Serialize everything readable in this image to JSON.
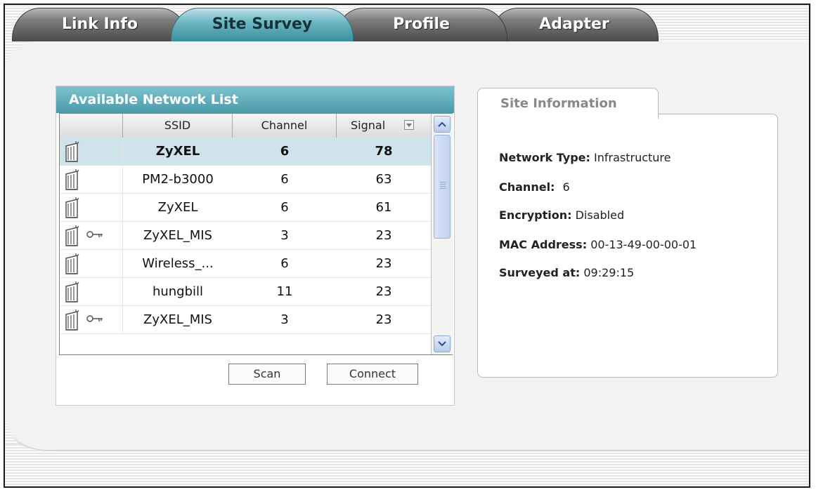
{
  "tabs": [
    {
      "label": "Link Info"
    },
    {
      "label": "Site Survey"
    },
    {
      "label": "Profile"
    },
    {
      "label": "Adapter"
    }
  ],
  "network_list": {
    "title": "Available Network List",
    "columns": {
      "ssid": "SSID",
      "channel": "Channel",
      "signal": "Signal"
    },
    "rows": [
      {
        "ssid": "ZyXEL",
        "channel": "6",
        "signal": "78",
        "encrypted": false,
        "selected": true
      },
      {
        "ssid": "PM2-b3000",
        "channel": "6",
        "signal": "63",
        "encrypted": false,
        "selected": false
      },
      {
        "ssid": "ZyXEL",
        "channel": "6",
        "signal": "61",
        "encrypted": false,
        "selected": false
      },
      {
        "ssid": "ZyXEL_MIS",
        "channel": "3",
        "signal": "23",
        "encrypted": true,
        "selected": false
      },
      {
        "ssid": "Wireless_...",
        "channel": "6",
        "signal": "23",
        "encrypted": false,
        "selected": false
      },
      {
        "ssid": "hungbill",
        "channel": "11",
        "signal": "23",
        "encrypted": false,
        "selected": false
      },
      {
        "ssid": "ZyXEL_MIS",
        "channel": "3",
        "signal": "23",
        "encrypted": true,
        "selected": false
      }
    ],
    "scan_label": "Scan",
    "connect_label": "Connect"
  },
  "site_info": {
    "title": "Site Information",
    "network_type_label": "Network Type:",
    "network_type_value": "Infrastructure",
    "channel_label": "Channel:",
    "channel_value": "6",
    "encryption_label": "Encryption:",
    "encryption_value": "Disabled",
    "mac_label": "MAC Address:",
    "mac_value": "00-13-49-00-00-01",
    "surveyed_label": "Surveyed at:",
    "surveyed_value": "09:29:15"
  },
  "colors": {
    "accent_teal": "#4a9aa8",
    "selected_row": "#cfe4ea",
    "tab_gray": "#4a4a4a"
  }
}
